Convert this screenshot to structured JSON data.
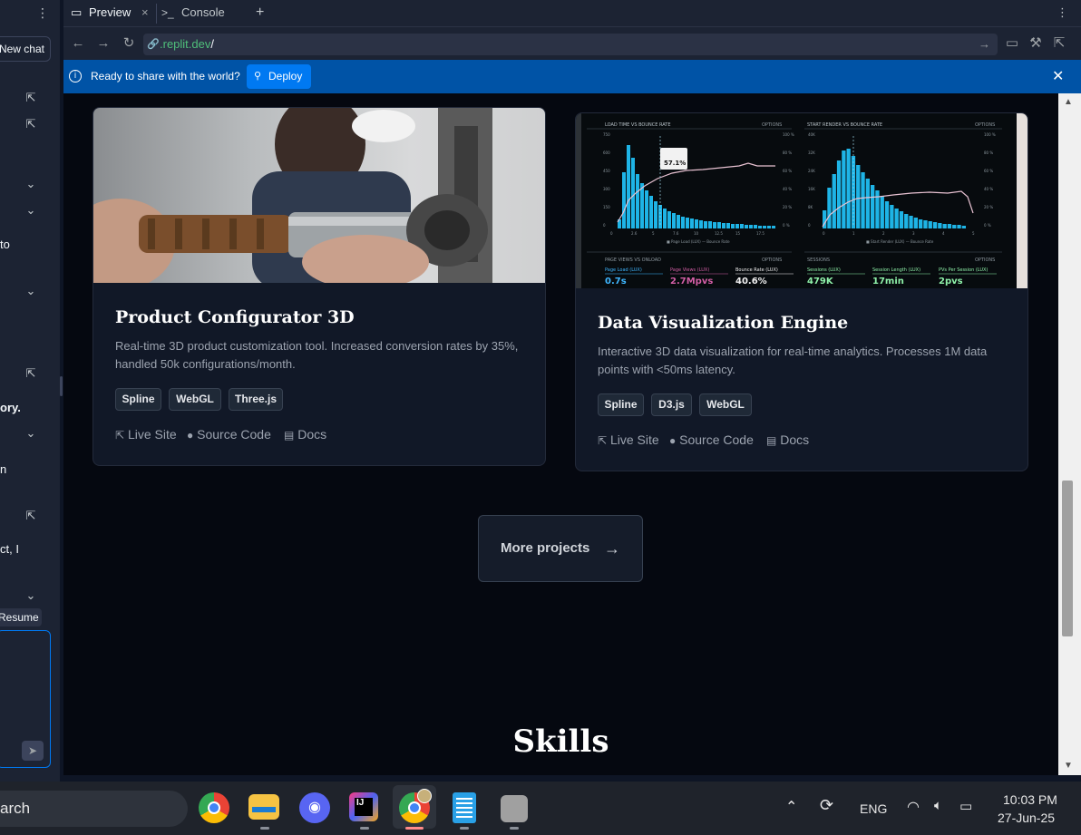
{
  "left_panel": {
    "new_chat_label": "New chat",
    "snippets": [
      "to",
      "ory.",
      "n",
      "ct, I"
    ],
    "resume_label": "Resume",
    "icons": [
      "open-external-icon",
      "chevron-down-icon",
      "send-icon"
    ]
  },
  "tabs": [
    {
      "label": "Preview",
      "icon": "monitor-icon",
      "active": true
    },
    {
      "label": "Console",
      "icon": "terminal-icon",
      "active": false
    }
  ],
  "tab_add": "+",
  "url": {
    "host": ".replit.dev",
    "path": "/"
  },
  "deploy_bar": {
    "message": "Ready to share with the world?",
    "button_label": "Deploy",
    "bg": "#0053a6"
  },
  "projects": [
    {
      "title": "Product Configurator 3D",
      "description": "Real-time 3D product customization tool. Increased conversion rates by 35%, handled 50k configurations/month.",
      "tags": [
        "Spline",
        "WebGL",
        "Three.js"
      ],
      "links": [
        "Live Site",
        "Source Code",
        "Docs"
      ]
    },
    {
      "title": "Data Visualization Engine",
      "description": "Interactive 3D data visualization for real-time analytics. Processes 1M data points with <50ms latency.",
      "tags": [
        "Spline",
        "D3.js",
        "WebGL"
      ],
      "links": [
        "Live Site",
        "Source Code",
        "Docs"
      ]
    }
  ],
  "dashboard_image": {
    "panel1_title": "LOAD TIME VS BOUNCE RATE",
    "panel2_title": "START RENDER VS BOUNCE RATE",
    "options": "OPTIONS",
    "tooltip": "57.1%",
    "bottom_left_title": "PAGE VIEWS VS ONLOAD",
    "bottom_right_title": "SESSIONS",
    "metrics": [
      {
        "label": "Page Load (LUX)",
        "value": "0.7s",
        "color": "#3fb6ff"
      },
      {
        "label": "Page Views (LUX)",
        "value": "2.7Mpvs",
        "color": "#d35ea5"
      },
      {
        "label": "Bounce Rate (LUX)",
        "value": "40.6%",
        "color": "#f1f1f1"
      },
      {
        "label": "Sessions (LUX)",
        "value": "479K",
        "color": "#8ef0a8"
      },
      {
        "label": "Session Length (LUX)",
        "value": "17min",
        "color": "#8ef0a8"
      },
      {
        "label": "PVs Per Session (LUX)",
        "value": "2pvs",
        "color": "#8ef0a8"
      }
    ],
    "left_y_ticks": [
      "750",
      "600",
      "450",
      "300",
      "150",
      "0"
    ],
    "right_y_ticks": [
      "100 %",
      "80 %",
      "60 %",
      "40 %",
      "20 %",
      "0 %"
    ],
    "left2_y_ticks": [
      "40K",
      "32K",
      "24K",
      "16K",
      "8K",
      "0"
    ],
    "x1_ticks": [
      "0",
      "2.6",
      "5",
      "7.6",
      "10",
      "12.5",
      "15",
      "17.5"
    ],
    "x2_ticks": [
      "0",
      "1",
      "2",
      "3",
      "4",
      "5"
    ],
    "legend1": [
      "Page Load (LUX)",
      "Bounce Rate"
    ],
    "legend2": [
      "Start Render (LUX)",
      "Bounce Rate"
    ],
    "accent": "#1eb4e6"
  },
  "more_projects_label": "More projects",
  "skills_heading": "Skills",
  "taskbar": {
    "search_text": "arch",
    "apps": [
      "chrome-icon",
      "file-explorer-icon",
      "discord-icon",
      "intellij-icon",
      "chrome-profile-icon",
      "notepad-icon",
      "app-icon"
    ],
    "lang": "ENG",
    "time": "10:03 PM",
    "date": "27-Jun-25"
  }
}
